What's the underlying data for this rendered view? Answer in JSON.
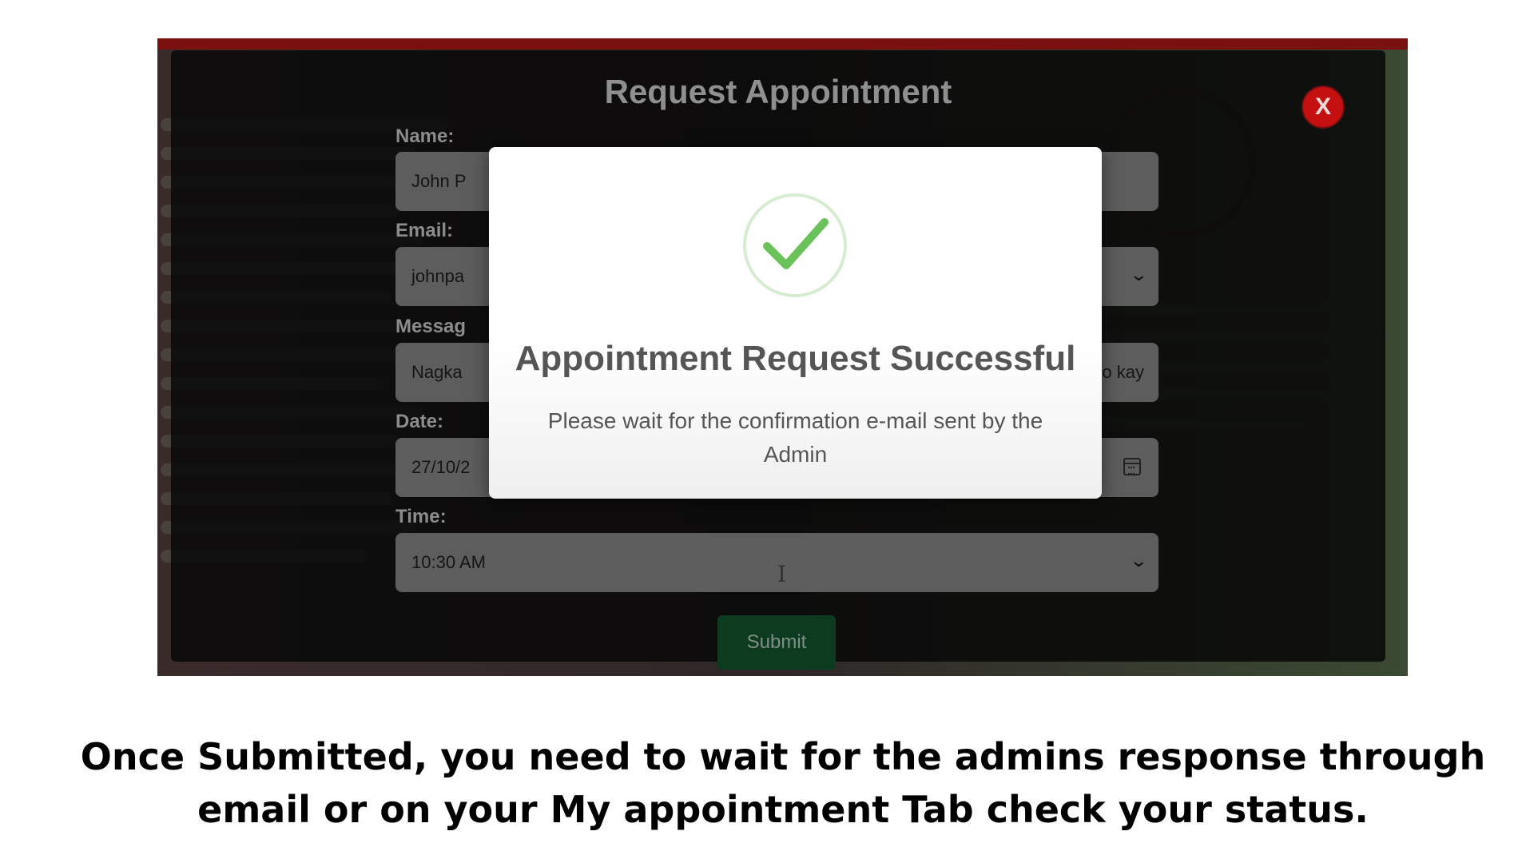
{
  "modal": {
    "title": "Request Appointment",
    "close_label": "X",
    "fields": {
      "name_label": "Name:",
      "name_value": "John P",
      "email_label": "Email:",
      "email_value": "johnpa",
      "message_label": "Messag",
      "message_value": "Nagka",
      "message_tail": "po kay",
      "date_label": "Date:",
      "date_value": "27/10/2",
      "time_label": "Time:",
      "time_value": "10:30 AM"
    },
    "submit_label": "Submit"
  },
  "success_popup": {
    "title": "Appointment Request Successful",
    "message": "Please wait for the confirmation e-mail sent by the Admin",
    "icon": "check-circle-icon"
  },
  "caption": "Once Submitted, you need to wait for the admins response through email or on your My appointment Tab check your status.",
  "colors": {
    "close_button": "#c41010",
    "submit_button": "#0c3b1f",
    "success_check": "#6cc25a"
  }
}
